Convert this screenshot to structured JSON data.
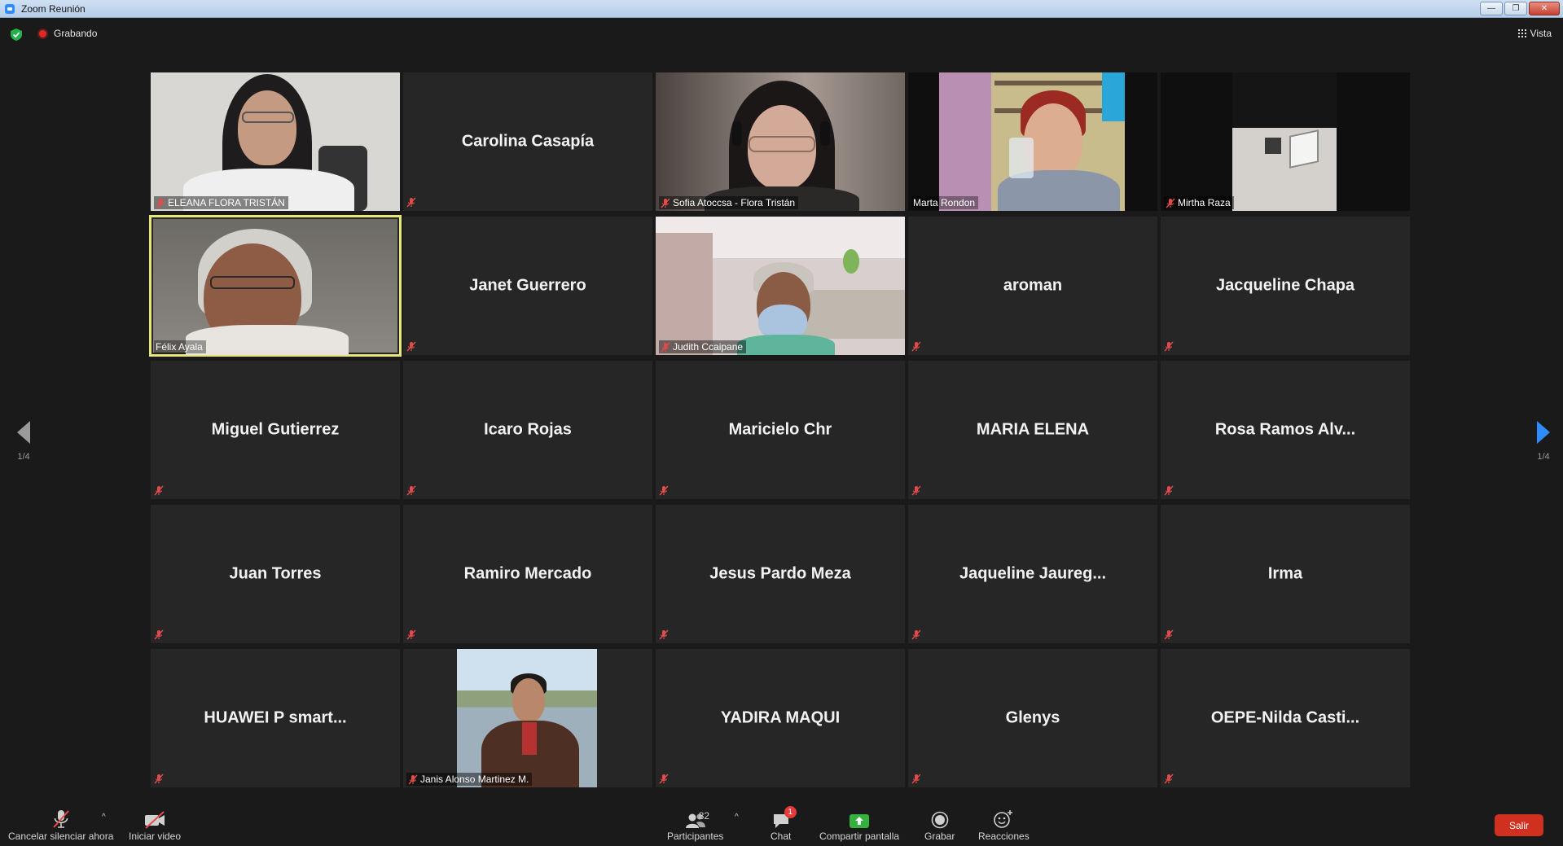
{
  "window": {
    "title": "Zoom Reunión",
    "min_label": "—",
    "max_label": "❐",
    "close_label": "✕"
  },
  "topbar": {
    "recording_label": "Grabando",
    "view_label": "Vista"
  },
  "navigation": {
    "page_left": "1/4",
    "page_right": "1/4"
  },
  "tiles": [
    {
      "name": "ELEANA FLORA TRISTÁN",
      "video": true
    },
    {
      "name": "Carolina Casapía",
      "video": false
    },
    {
      "name": "Sofia Atoccsa - Flora Tristán",
      "video": true
    },
    {
      "name": "Marta Rondon",
      "video": true
    },
    {
      "name": "Mirtha Raza",
      "video": true
    },
    {
      "name": "Félix Ayala",
      "video": true,
      "active_speaker": true
    },
    {
      "name": "Janet Guerrero",
      "video": false
    },
    {
      "name": "Judith Ccaipane",
      "video": true
    },
    {
      "name": "aroman",
      "video": false
    },
    {
      "name": "Jacqueline Chapa",
      "video": false
    },
    {
      "name": "Miguel Gutierrez",
      "video": false
    },
    {
      "name": "Icaro Rojas",
      "video": false
    },
    {
      "name": "Maricielo Chr",
      "video": false
    },
    {
      "name": "MARIA ELENA",
      "video": false
    },
    {
      "name": "Rosa  Ramos Alv...",
      "video": false
    },
    {
      "name": "Juan Torres",
      "video": false
    },
    {
      "name": "Ramiro Mercado",
      "video": false
    },
    {
      "name": "Jesus Pardo Meza",
      "video": false
    },
    {
      "name": "Jaqueline  Jaureg...",
      "video": false
    },
    {
      "name": "Irma",
      "video": false
    },
    {
      "name": "HUAWEI P smart...",
      "video": false
    },
    {
      "name": "Janis Alonso Martinez M.",
      "video": true
    },
    {
      "name": "YADIRA MAQUI",
      "video": false
    },
    {
      "name": "Glenys",
      "video": false
    },
    {
      "name": "OEPE-Nilda Casti...",
      "video": false
    }
  ],
  "toolbar": {
    "unmute_label": "Cancelar silenciar ahora",
    "video_label": "Iniciar video",
    "participants_label": "Participantes",
    "participants_count": "82",
    "chat_label": "Chat",
    "chat_badge": "1",
    "share_label": "Compartir pantalla",
    "record_label": "Grabar",
    "reactions_label": "Reacciones",
    "leave_label": "Salir"
  },
  "colors": {
    "accent": "#2d8cff",
    "active_speaker": "#e6e679",
    "share": "#55c555",
    "leave": "#d0301f",
    "recording": "#e02828"
  }
}
